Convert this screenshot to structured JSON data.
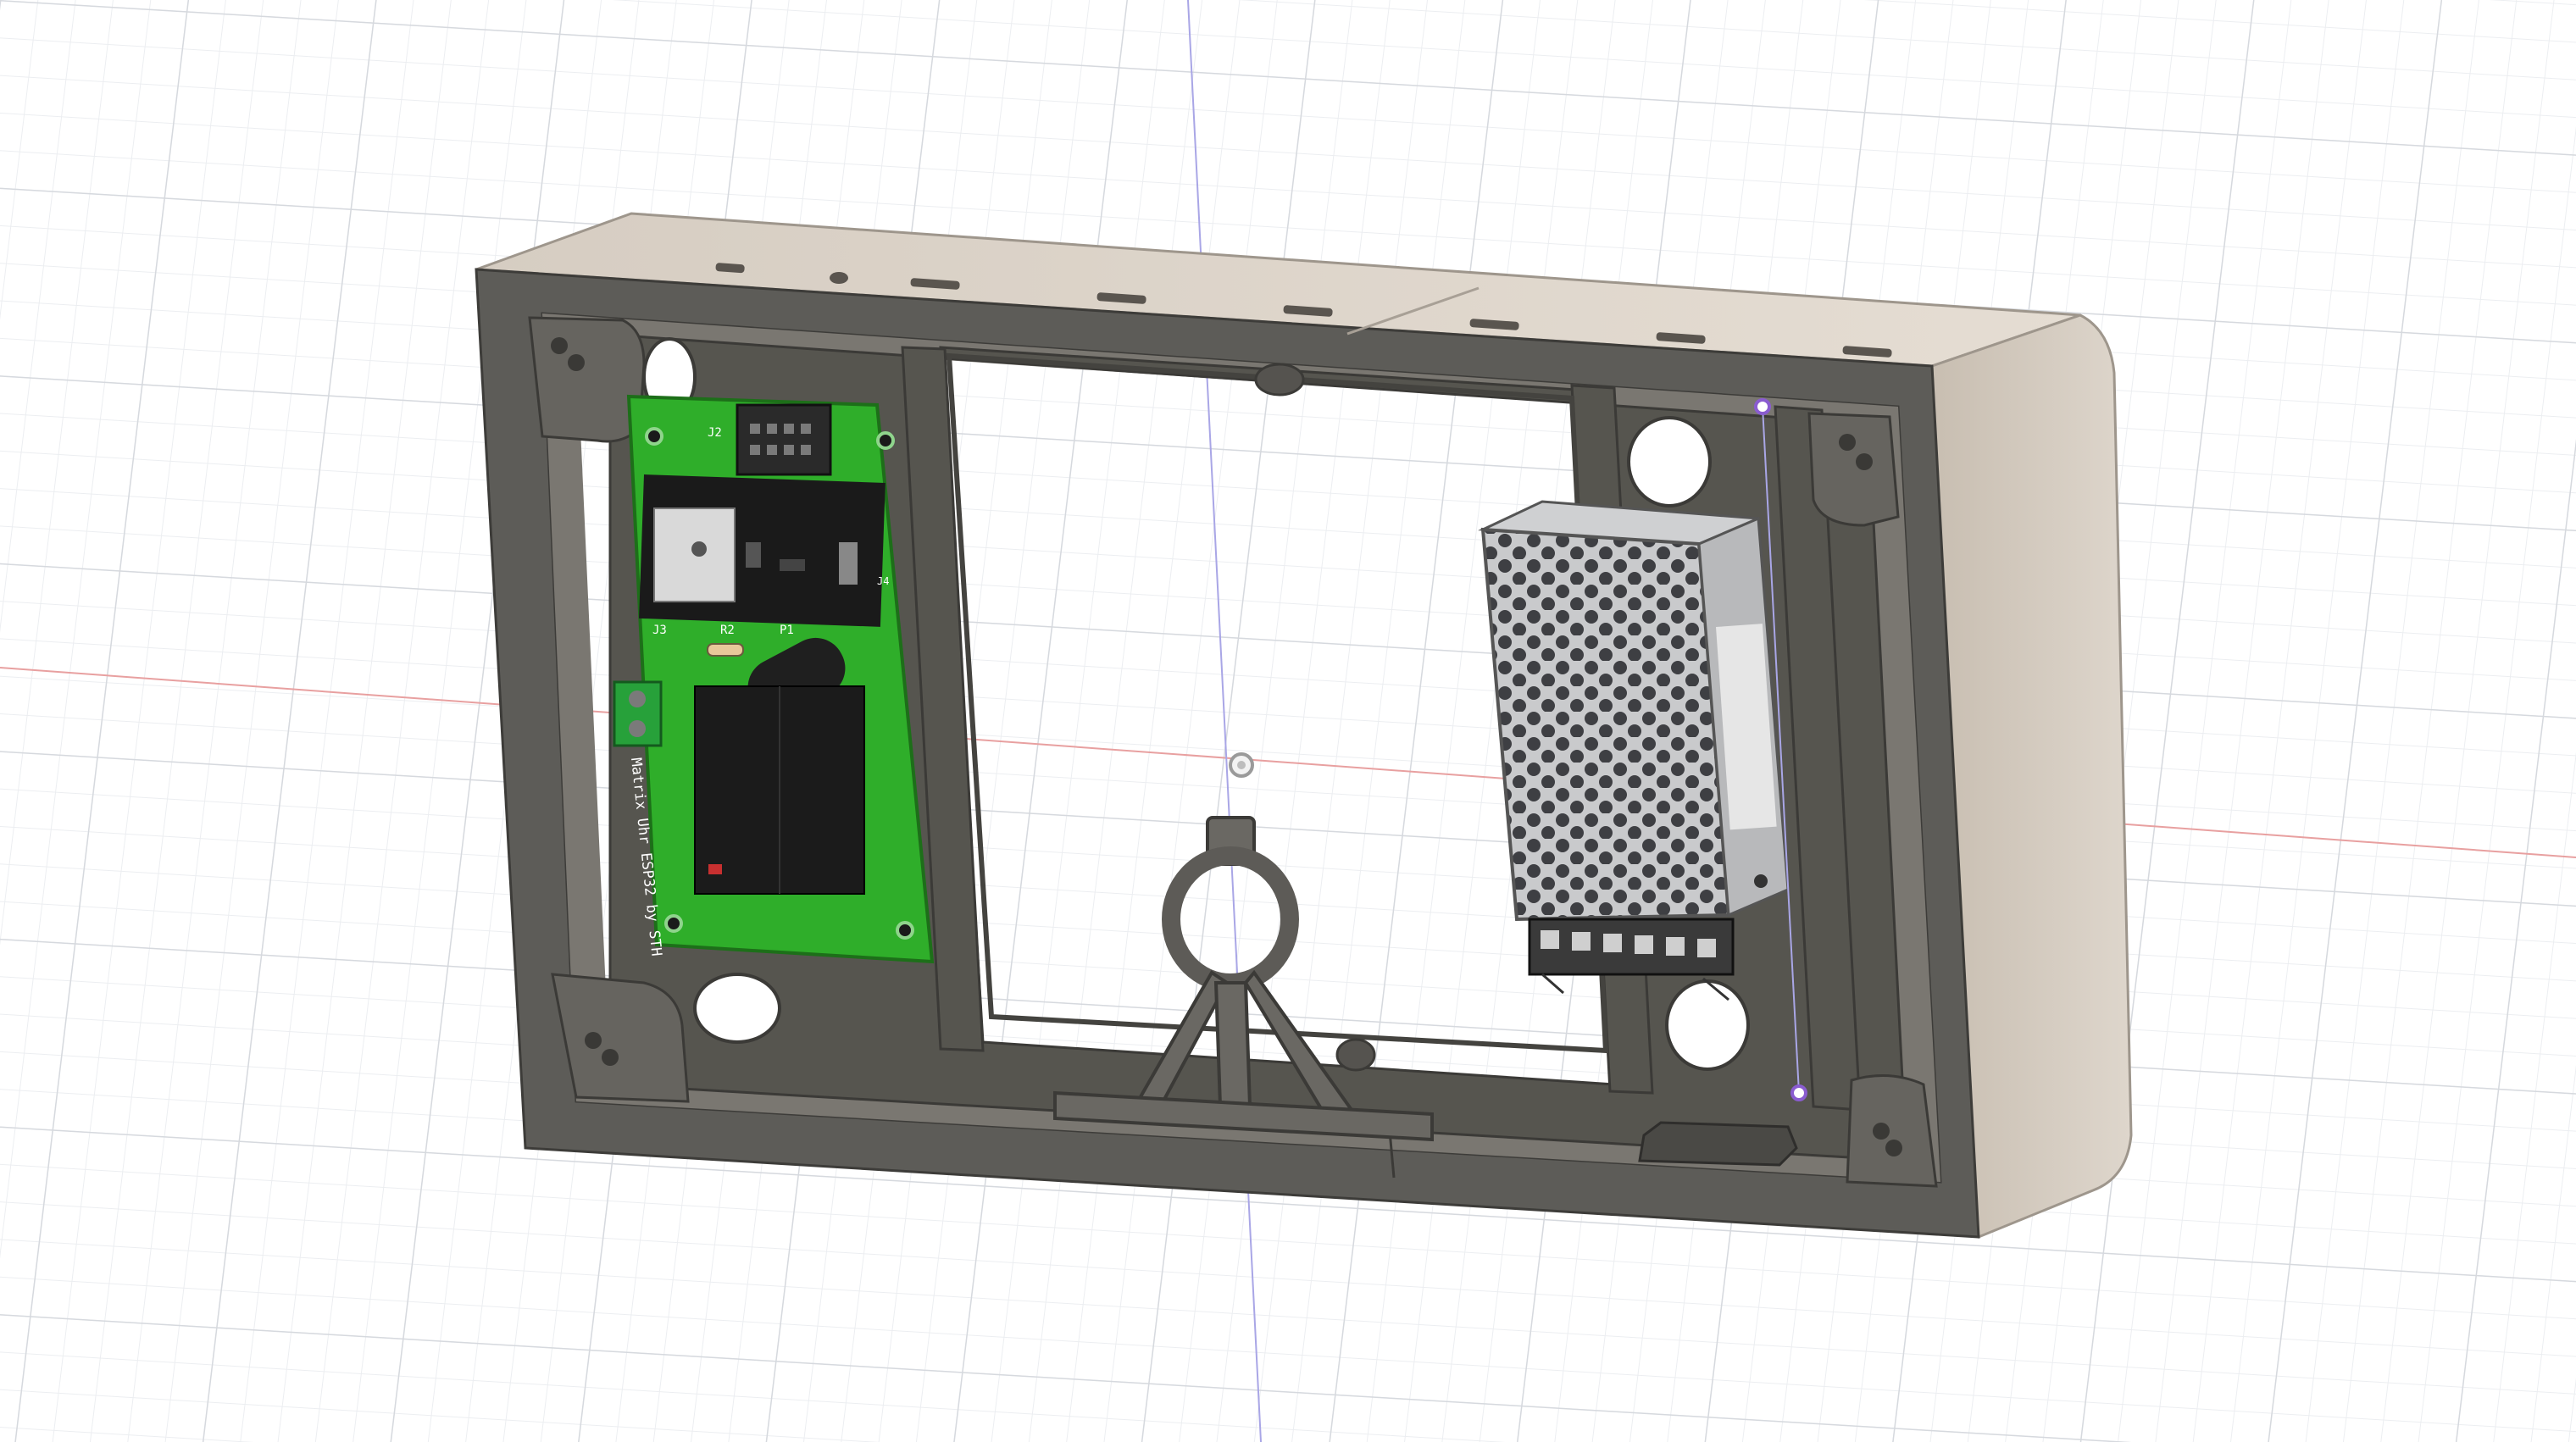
{
  "viewport": {
    "background": "#ffffff",
    "grid_major_color": "#d6d9de",
    "grid_minor_color": "#eceef1",
    "x_axis_color": "#e8a0a0",
    "y_axis_color": "#a9a6e6",
    "origin_marker": "origin-icon"
  },
  "model": {
    "frame_color": "#5b5a56",
    "frame_top_color": "#d8cfc4",
    "frame_side_color": "#cbc2b6",
    "frame_inner_color": "#7a7771"
  },
  "pcb": {
    "board_color": "#2fae2a",
    "silkscreen_text": "Matrix Uhr ESP32 by STH",
    "ref_j2": "J2",
    "ref_j3": "J3",
    "ref_r2": "R2",
    "ref_p1": "P1",
    "ref_j4": "J4"
  },
  "power_supply": {
    "housing_color": "#bfc0c2",
    "pattern": "perforated-mesh",
    "terminal_color": "#3a3a3a"
  },
  "constraint_points": {
    "color": "#8a5cd0"
  }
}
